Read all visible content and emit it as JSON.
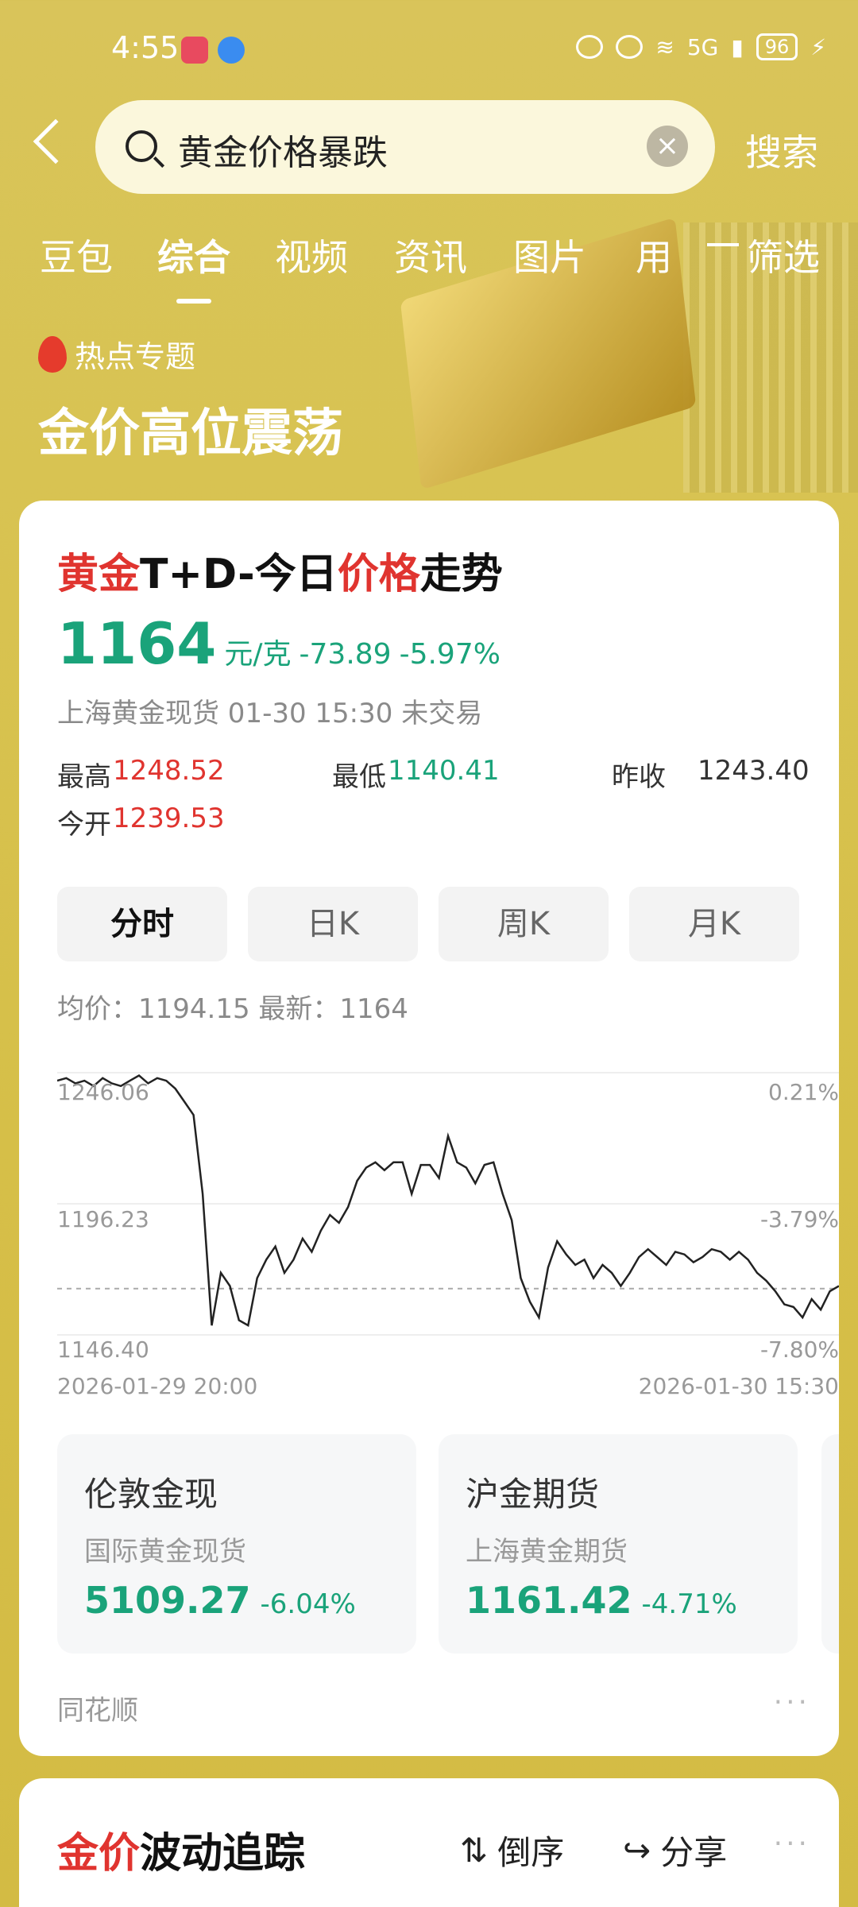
{
  "status": {
    "time": "4:55",
    "battery": "96",
    "network": "5G"
  },
  "search": {
    "query": "黄金价格暴跌",
    "button": "搜索"
  },
  "tabs": [
    "豆包",
    "综合",
    "视频",
    "资讯",
    "图片",
    "用"
  ],
  "active_tab": "综合",
  "filter_label": "筛选",
  "hero": {
    "hot_label": "热点专题",
    "title": "金价高位震荡"
  },
  "card": {
    "title_red1": "黄金",
    "title_mid": "T+D-今日",
    "title_red2": "价格",
    "title_end": "走势",
    "price": "1164",
    "unit": "元/克",
    "change": "-73.89",
    "pct": "-5.97%",
    "sub": "上海黄金现货 01-30 15:30 未交易",
    "stats": {
      "high_label": "最高",
      "high": "1248.52",
      "low_label": "最低",
      "low": "1140.41",
      "prev_label": "昨收",
      "prev": "1243.40",
      "open_label": "今开",
      "open": "1239.53"
    },
    "segments": [
      "分时",
      "日K",
      "周K",
      "月K"
    ],
    "avg_row": "均价：1194.15  最新：1164"
  },
  "chart_data": {
    "type": "line",
    "y_labels_left": [
      "1246.06",
      "1196.23",
      "1146.40"
    ],
    "y_labels_right": [
      "0.21%",
      "-3.79%",
      "-7.80%"
    ],
    "x_labels": [
      "2026-01-29 20:00",
      "2026-01-30 15:30"
    ],
    "ylim": [
      1146.4,
      1246.06
    ],
    "reference_line": 1164,
    "series": [
      {
        "values": [
          1243,
          1244,
          1242,
          1243,
          1241,
          1244,
          1242,
          1241,
          1243,
          1245,
          1242,
          1244,
          1243,
          1240,
          1235,
          1230,
          1200,
          1150,
          1170,
          1165,
          1152,
          1150,
          1168,
          1175,
          1180,
          1170,
          1175,
          1183,
          1178,
          1186,
          1192,
          1189,
          1195,
          1205,
          1210,
          1212,
          1209,
          1212,
          1212,
          1200,
          1211,
          1211,
          1206,
          1222,
          1212,
          1210,
          1204,
          1211,
          1212,
          1200,
          1190,
          1168,
          1159,
          1153,
          1172,
          1182,
          1177,
          1173,
          1175,
          1168,
          1173,
          1170,
          1165,
          1170,
          1176,
          1179,
          1176,
          1173,
          1178,
          1177,
          1174,
          1176,
          1179,
          1178,
          1175,
          1178,
          1175,
          1170,
          1167,
          1163,
          1158,
          1157,
          1153,
          1160,
          1156,
          1163,
          1165
        ]
      }
    ]
  },
  "mini_cards": [
    {
      "title": "伦敦金现",
      "sub": "国际黄金现货",
      "value": "5109.27",
      "pct": "-6.04%"
    },
    {
      "title": "沪金期货",
      "sub": "上海黄金期货",
      "value": "1161.42",
      "pct": "-4.71%"
    }
  ],
  "source": "同花顺",
  "card2": {
    "title_red": "金价",
    "title_end": "波动追踪",
    "sort": "倒序",
    "share": "分享"
  },
  "colors": {
    "background": "#d8c352",
    "up": "#e0342f",
    "down": "#1aa37a"
  }
}
